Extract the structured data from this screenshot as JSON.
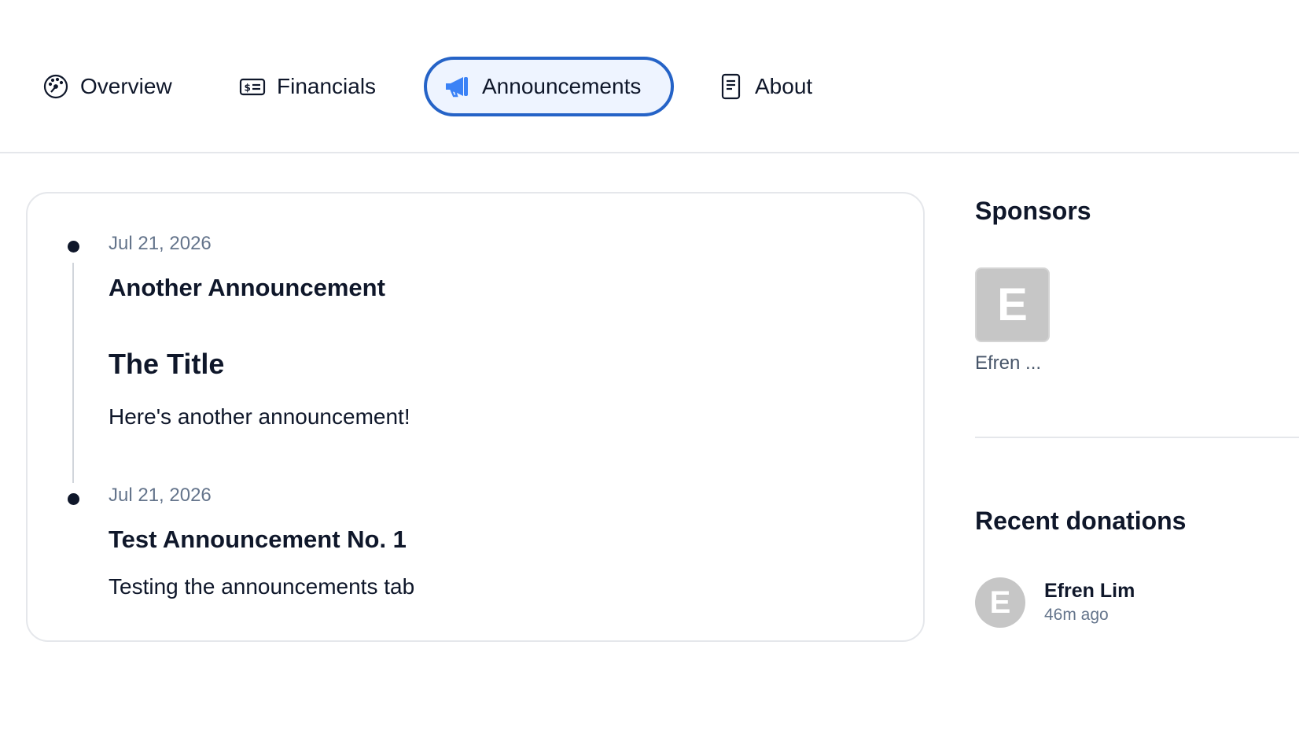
{
  "tabs": [
    {
      "label": "Overview",
      "icon": "gauge-icon",
      "active": false
    },
    {
      "label": "Financials",
      "icon": "money-bill-icon",
      "active": false
    },
    {
      "label": "Announcements",
      "icon": "megaphone-icon",
      "active": true
    },
    {
      "label": "About",
      "icon": "document-icon",
      "active": false
    }
  ],
  "announcements": [
    {
      "date": "Jul 21, 2026",
      "title": "Another Announcement",
      "heading": "The Title",
      "body": "Here's another announcement!"
    },
    {
      "date": "Jul 21, 2026",
      "title": "Test Announcement No. 1",
      "body": "Testing the announcements tab"
    }
  ],
  "sidebar": {
    "sponsors_heading": "Sponsors",
    "sponsors": [
      {
        "initial": "E",
        "name": "Efren ..."
      }
    ],
    "donations_heading": "Recent donations",
    "donations": [
      {
        "initial": "E",
        "name": "Efren Lim",
        "time": "46m ago"
      }
    ]
  },
  "colors": {
    "accent": "#2563c7",
    "active_tab_bg": "#eef4ff",
    "megaphone": "#3b82f6",
    "avatar_bg": "#c6c6c6"
  }
}
